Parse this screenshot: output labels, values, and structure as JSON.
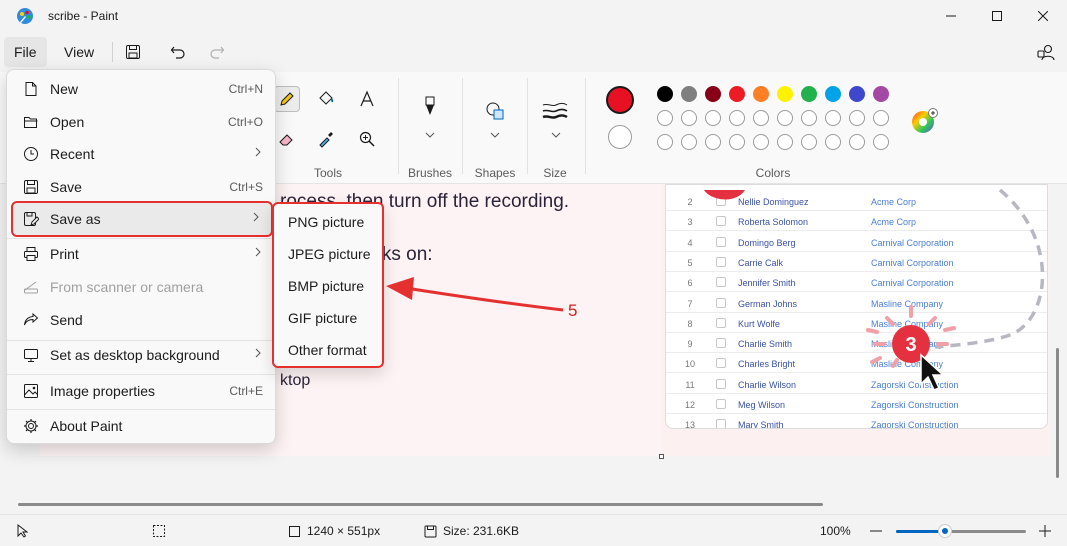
{
  "window": {
    "title": "scribe - Paint",
    "minimize": "minimize-icon",
    "maximize": "maximize-icon",
    "close": "close-icon"
  },
  "menubar": {
    "file": "File",
    "view": "View"
  },
  "ribbon": {
    "groups": {
      "tools": "Tools",
      "brushes": "Brushes",
      "shapes": "Shapes",
      "size": "Size",
      "colors": "Colors"
    },
    "primary_color": "#e81123",
    "palette_row1": [
      "#000000",
      "#7f7f7f",
      "#880015",
      "#ed1c24",
      "#ff7f27",
      "#fff200",
      "#22b14c",
      "#00a2e8",
      "#3f48cc",
      "#a349a4"
    ],
    "palette_row2": [
      "#ffffff",
      "#c3c3c3",
      "#b97a57",
      "#ffaec9",
      "#ffc90e",
      "#efe4b0",
      "#b5e61d",
      "#99d9ea",
      "#7092be",
      "#c8bfe7"
    ]
  },
  "file_menu": {
    "items": [
      {
        "label": "New",
        "shortcut": "Ctrl+N"
      },
      {
        "label": "Open",
        "shortcut": "Ctrl+O"
      },
      {
        "label": "Recent",
        "shortcut": ""
      },
      {
        "label": "Save",
        "shortcut": "Ctrl+S"
      },
      {
        "label": "Save as",
        "shortcut": ""
      },
      {
        "label": "Print",
        "shortcut": ""
      },
      {
        "label": "From scanner or camera",
        "shortcut": ""
      },
      {
        "label": "Send",
        "shortcut": ""
      },
      {
        "label": "Set as desktop background",
        "shortcut": ""
      },
      {
        "label": "Image properties",
        "shortcut": "Ctrl+E"
      },
      {
        "label": "About Paint",
        "shortcut": ""
      }
    ]
  },
  "save_as_menu": {
    "items": [
      "PNG picture",
      "JPEG picture",
      "BMP picture",
      "GIF picture",
      "Other format"
    ]
  },
  "canvas": {
    "text_line1": "rocess, then turn off the recording.",
    "text_line2": "orks on:",
    "text_line3": "ktop",
    "annotation_arrow_label": "5",
    "step_badge": "3",
    "table_rows": [
      {
        "num": "2",
        "name": "Nellie Dominguez",
        "company": "Acme Corp"
      },
      {
        "num": "3",
        "name": "Roberta Solomon",
        "company": "Acme Corp"
      },
      {
        "num": "4",
        "name": "Domingo Berg",
        "company": "Carnival Corporation"
      },
      {
        "num": "5",
        "name": "Carrie Calk",
        "company": "Carnival Corporation"
      },
      {
        "num": "6",
        "name": "Jennifer Smith",
        "company": "Carnival Corporation"
      },
      {
        "num": "7",
        "name": "German Johns",
        "company": "Masline Company"
      },
      {
        "num": "8",
        "name": "Kurt Wolfe",
        "company": "Masline Company"
      },
      {
        "num": "9",
        "name": "Charlie Smith",
        "company": "Masline Company"
      },
      {
        "num": "10",
        "name": "Charles Bright",
        "company": "Masline Company"
      },
      {
        "num": "11",
        "name": "Charlie Wilson",
        "company": "Zagorski Construction"
      },
      {
        "num": "12",
        "name": "Meg Wilson",
        "company": "Zagorski Construction"
      },
      {
        "num": "13",
        "name": "Mary Smith",
        "company": "Zagorski Construction"
      }
    ]
  },
  "statusbar": {
    "dimensions": "1240 × 551px",
    "size": "Size: 231.6KB",
    "zoom": "100%",
    "zoom_level": 0.38
  }
}
